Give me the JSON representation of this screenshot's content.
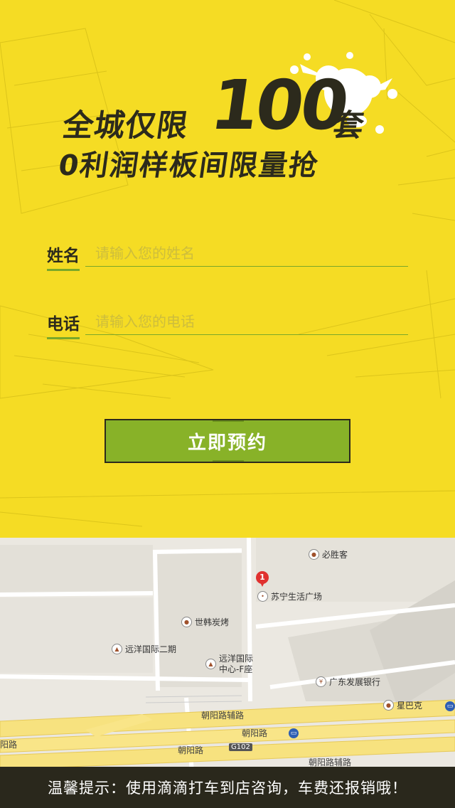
{
  "headline": {
    "line1_prefix": "全城仅限",
    "number": "100",
    "line1_suffix": "套",
    "line2": "0利润样板间限量抢"
  },
  "form": {
    "name_label": "姓名",
    "name_placeholder": "请输入您的姓名",
    "phone_label": "电话",
    "phone_placeholder": "请输入您的电话",
    "submit_label": "立即预约"
  },
  "map": {
    "pin_number": "1",
    "pois": {
      "pizza_hut": "必胜客",
      "suning": "苏宁生活广场",
      "korean_bbq": "世韩炭烤",
      "yuanyang_phase2": "远洋国际二期",
      "yuanyang_f_line1": "远洋国际",
      "yuanyang_f_line2": "中心-F座",
      "gdb_bank": "广东发展银行",
      "starbucks": "星巴克"
    },
    "roads": {
      "chaoyang_aux_1": "朝阳路辅路",
      "chaoyang_1": "朝阳路",
      "chaoyang_2": "朝阳路",
      "chaoyang_aux_2": "朝阳路辅路",
      "left_edge": "阳路",
      "highway_badge": "G102"
    }
  },
  "footer": {
    "tip": "温馨提示：使用滴滴打车到店咨询，车费还报销哦！"
  },
  "colors": {
    "background": "#f5dc24",
    "text_dark": "#2c2a1c",
    "accent_green": "#88b228",
    "footer_bg": "#2a281c"
  }
}
